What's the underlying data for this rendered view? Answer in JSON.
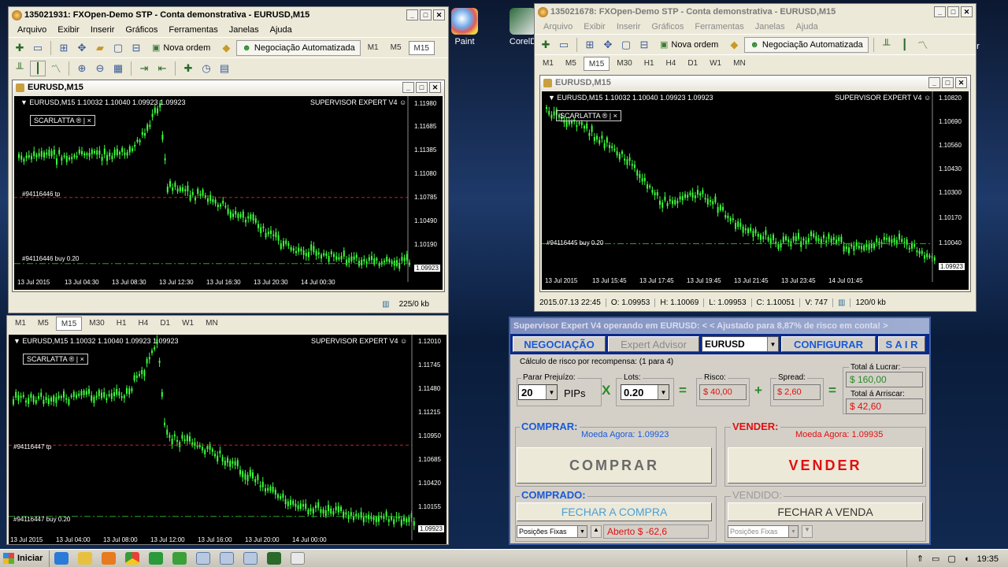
{
  "desktop": {
    "icons": [
      {
        "label": "Paint"
      },
      {
        "label": "CorelD"
      },
      {
        "label": "er"
      }
    ]
  },
  "win1": {
    "title": "135021931: FXOpen-Demo STP - Conta demonstrativa - EURUSD,M15",
    "menu": [
      "Arquivo",
      "Exibir",
      "Inserir",
      "Gráficos",
      "Ferramentas",
      "Janelas",
      "Ajuda"
    ],
    "new_order": "Nova ordem",
    "auto_trading": "Negociação Automatizada",
    "timeframes": [
      "M1",
      "M5",
      "M15"
    ],
    "tf_selected": "M15",
    "status_kb": "225/0 kb"
  },
  "chart1": {
    "title": "EURUSD,M15",
    "info": "▼ EURUSD,M15  1.10032 1.10040 1.09923 1.09923",
    "expert": "SUPERVISOR EXPERT V4 ☺",
    "scarlatta": "SCARLATTA ® |     ×",
    "tp_label": "#94116446 tp",
    "buy_label": "#94116446 buy 0.20",
    "prices": [
      "1.11980",
      "1.11685",
      "1.11385",
      "1.11080",
      "1.10785",
      "1.10490",
      "1.10190"
    ],
    "current": "1.09923",
    "times": [
      "13 Jul 2015",
      "13 Jul 04:30",
      "13 Jul 08:30",
      "13 Jul 12:30",
      "13 Jul 16:30",
      "13 Jul 20:30",
      "14 Jul 00:30"
    ]
  },
  "chart2": {
    "tfbar": [
      "M1",
      "M5",
      "M15",
      "M30",
      "H1",
      "H4",
      "D1",
      "W1",
      "MN"
    ],
    "tf_selected": "M15",
    "info": "▼ EURUSD,M15  1.10032 1.10040 1.09923 1.09923",
    "expert": "SUPERVISOR EXPERT V4 ☺",
    "scarlatta": "SCARLATTA ® |     ×",
    "tp_label": "#94116447 tp",
    "buy_label": "#94116447 buy 0.20",
    "prices": [
      "1.12010",
      "1.11745",
      "1.11480",
      "1.11215",
      "1.10950",
      "1.10685",
      "1.10420",
      "1.10155"
    ],
    "current": "1.09923",
    "times": [
      "13 Jul 2015",
      "13 Jul 04:00",
      "13 Jul 08:00",
      "13 Jul 12:00",
      "13 Jul 16:00",
      "13 Jul 20:00",
      "14 Jul 00:00"
    ]
  },
  "win2": {
    "title": "135021678: FXOpen-Demo STP - Conta demonstrativa - EURUSD,M15",
    "menu": [
      "Arquivo",
      "Exibir",
      "Inserir",
      "Gráficos",
      "Ferramentas",
      "Janelas",
      "Ajuda"
    ],
    "new_order": "Nova ordem",
    "auto_trading": "Negociação Automatizada",
    "timeframes": [
      "M1",
      "M5",
      "M15",
      "M30",
      "H1",
      "H4",
      "D1",
      "W1",
      "MN"
    ],
    "tf_selected": "M15",
    "status": {
      "datetime": "2015.07.13 22:45",
      "open": "O: 1.09953",
      "high": "H: 1.10069",
      "low": "L: 1.09953",
      "close": "C: 1.10051",
      "volume": "V: 747",
      "kb": "120/0 kb"
    }
  },
  "chart3": {
    "title": "EURUSD,M15",
    "info": "▼ EURUSD,M15  1.10032 1.10040 1.09923 1.09923",
    "expert": "SUPERVISOR EXPERT V4 ☺",
    "scarlatta": "SCARLATTA ® |     ×",
    "buy_label": "#94116445 buy 0.20",
    "prices": [
      "1.10820",
      "1.10690",
      "1.10560",
      "1.10430",
      "1.10300",
      "1.10170",
      "1.10040"
    ],
    "current": "1.09923",
    "times": [
      "13 Jul 2015",
      "13 Jul 15:45",
      "13 Jul 17:45",
      "13 Jul 19:45",
      "13 Jul 21:45",
      "13 Jul 23:45",
      "14 Jul 01:45"
    ]
  },
  "supervisor": {
    "title": "Supervisor  Expert  V4 operando em EURUSD: < <  Ajustado para 8,87% de risco em conta!  >",
    "nav": {
      "negociacao": "NEGOCIAÇÃO",
      "expert": "Expert Advisor",
      "symbol": "EURUSD",
      "config": "CONFIGURAR",
      "sair": "S A I R"
    },
    "risk": {
      "heading": "Cálculo de risco por recompensa: (1 para 4)",
      "stop_label": "Parar Prejuízo:",
      "stop_value": "20",
      "pips": "PIPs",
      "times": "X",
      "lots_label": "Lots:",
      "lots_value": "0.20",
      "eq": "=",
      "risk_label": "Risco:",
      "risk_value": "$ 40,00",
      "plus": "+",
      "spread_label": "Spread:",
      "spread_value": "$ 2,60",
      "eq2": "=",
      "profit_label": "Total á Lucrar:",
      "profit_value": "$ 160,00",
      "atrisk_label": "Total á Arriscar:",
      "atrisk_value": "$ 42,60"
    },
    "buy": {
      "heading": "COMPRAR:",
      "price": "Moeda Agora: 1.09923",
      "button": "COMPRAR"
    },
    "sell": {
      "heading": "VENDER:",
      "price": "Moeda Agora: 1.09935",
      "button": "VENDER"
    },
    "bought": {
      "heading": "COMPRADO:",
      "close": "FECHAR A COMPRA",
      "mode": "Posições Fixas",
      "open": "Aberto $ -62,6"
    },
    "sold": {
      "heading": "VENDIDO:",
      "close": "FECHAR A VENDA",
      "mode": "Posições Fixas"
    }
  },
  "taskbar": {
    "start": "Iniciar",
    "clock": "19:35"
  },
  "colors": {
    "candle": "#3cff3c",
    "tp": "#c81e1e",
    "buy": "#2aa32a",
    "accent": "#1a5ad8",
    "danger": "#e01010"
  }
}
